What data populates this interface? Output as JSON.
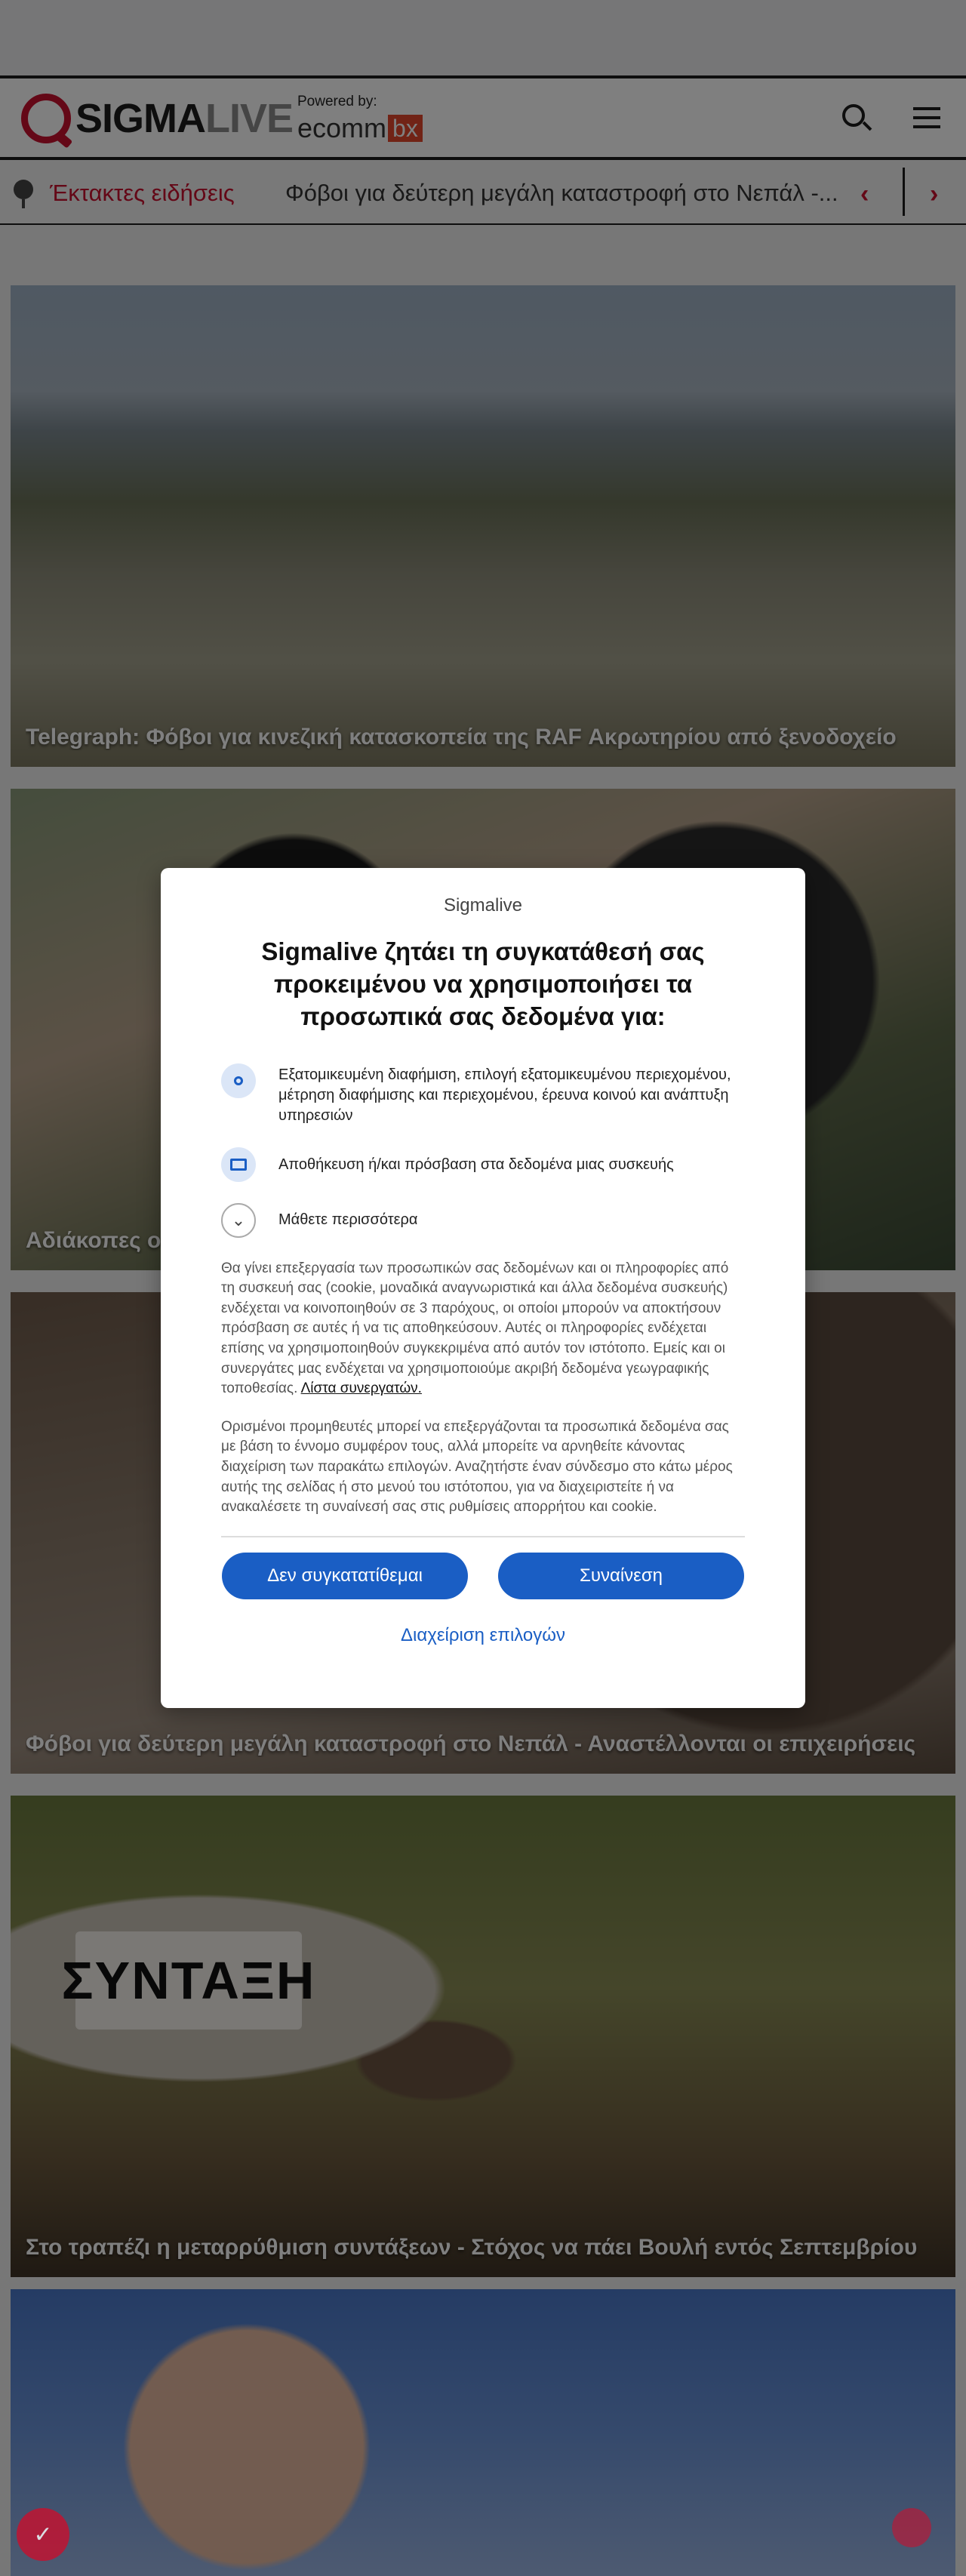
{
  "header": {
    "logo_part1": "SIGMA",
    "logo_part2": "LIVE",
    "powered_label": "Powered by:",
    "partner_part1": "ecomm",
    "partner_part2": "bx"
  },
  "breaking": {
    "label": "Έκτακτες ειδήσεις",
    "headline": "Φόβοι για δεύτερη μεγάλη καταστροφή στο Νεπάλ -...",
    "prev_glyph": "‹",
    "next_glyph": "›"
  },
  "articles": [
    {
      "title": "Telegraph: Φόβοι για κινεζική κατασκοπεία της RAF Ακρωτηρίου από ξενοδοχείο"
    },
    {
      "title": "Αδιάκοπες ο"
    },
    {
      "title": "Φόβοι για δεύτερη μεγάλη καταστροφή στο Νεπάλ - Αναστέλλονται οι επιχειρήσεις"
    },
    {
      "title": "Στο τραπέζι η μεταρρύθμιση συντάξεων - Στόχος να πάει Βουλή εντός Σεπτεμβρίου",
      "image_text": "ΣΥΝΤΑΞΗ"
    },
    {
      "title": ""
    }
  ],
  "consent": {
    "brand": "Sigmalive",
    "title": "Sigmalive ζητάει τη συγκατάθεσή σας προκειμένου να χρησιμοποιήσει τα προσωπικά σας δεδομένα για:",
    "purposes": [
      {
        "icon": "user-icon",
        "text": "Εξατομικευμένη διαφήμιση, επιλογή εξατομικευμένου περιεχομένου, μέτρηση διαφήμισης και περιεχομένου, έρευνα κοινού και ανάπτυξη υπηρεσιών"
      },
      {
        "icon": "device-icon",
        "text": "Αποθήκευση ή/και πρόσβαση στα δεδομένα μιας συσκευής"
      }
    ],
    "learn_more": "Μάθετε περισσότερα",
    "body1": "Θα γίνει επεξεργασία των προσωπικών σας δεδομένων και οι πληροφορίες από τη συσκευή σας (cookie, μοναδικά αναγνωριστικά και άλλα δεδομένα συσκευής) ενδέχεται να κοινοποιηθούν σε 3 παρόχους, οι οποίοι μπορούν να αποκτήσουν πρόσβαση σε αυτές ή να τις αποθηκεύσουν. Αυτές οι πληροφορίες ενδέχεται επίσης να χρησιμοποιηθούν συγκεκριμένα από αυτόν τον ιστότοπο. Εμείς και οι συνεργάτες μας ενδέχεται να χρησιμοποιούμε ακριβή δεδομένα γεωγραφικής τοποθεσίας.",
    "partners_link": "Λίστα συνεργατών.",
    "body2": "Ορισμένοι προμηθευτές μπορεί να επεξεργάζονται τα προσωπικά δεδομένα σας με βάση το έννομο συμφέρον τους, αλλά μπορείτε να αρνηθείτε κάνοντας διαχείριση των παρακάτω επιλογών. Αναζητήστε έναν σύνδεσμο στο κάτω μέρος αυτής της σελίδας ή στο μενού του ιστότοπου, για να διαχειριστείτε ή να ανακαλέσετε τη συναίνεσή σας στις ρυθμίσεις απορρήτου και cookie.",
    "reject_label": "Δεν συγκατατίθεμαι",
    "accept_label": "Συναίνεση",
    "manage_label": "Διαχείριση επιλογών"
  },
  "colors": {
    "brand_red": "#c8102e",
    "consent_blue": "#1a5ec4"
  }
}
